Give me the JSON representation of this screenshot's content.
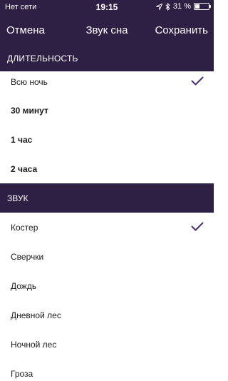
{
  "status_bar": {
    "carrier": "Нет сети",
    "time": "19:15",
    "battery_percent_text": "31 %",
    "battery_level": 0.31
  },
  "nav": {
    "cancel_label": "Отмена",
    "title": "Звук сна",
    "save_label": "Сохранить"
  },
  "duration": {
    "header": "ДЛИТЕЛЬНОСТЬ",
    "items": [
      {
        "label": "Всю ночь",
        "selected": true
      },
      {
        "label": "30 минут",
        "selected": false
      },
      {
        "label": "1 час",
        "selected": false
      },
      {
        "label": "2 часа",
        "selected": false
      }
    ]
  },
  "sound": {
    "header": "ЗВУК",
    "items": [
      {
        "label": "Костер",
        "selected": true
      },
      {
        "label": "Сверчки",
        "selected": false
      },
      {
        "label": "Дождь",
        "selected": false
      },
      {
        "label": "Дневной лес",
        "selected": false
      },
      {
        "label": "Ночной лес",
        "selected": false
      },
      {
        "label": "Гроза",
        "selected": false
      }
    ]
  },
  "colors": {
    "header_bg": "#2e1f45",
    "check": "#4a2f6b"
  }
}
